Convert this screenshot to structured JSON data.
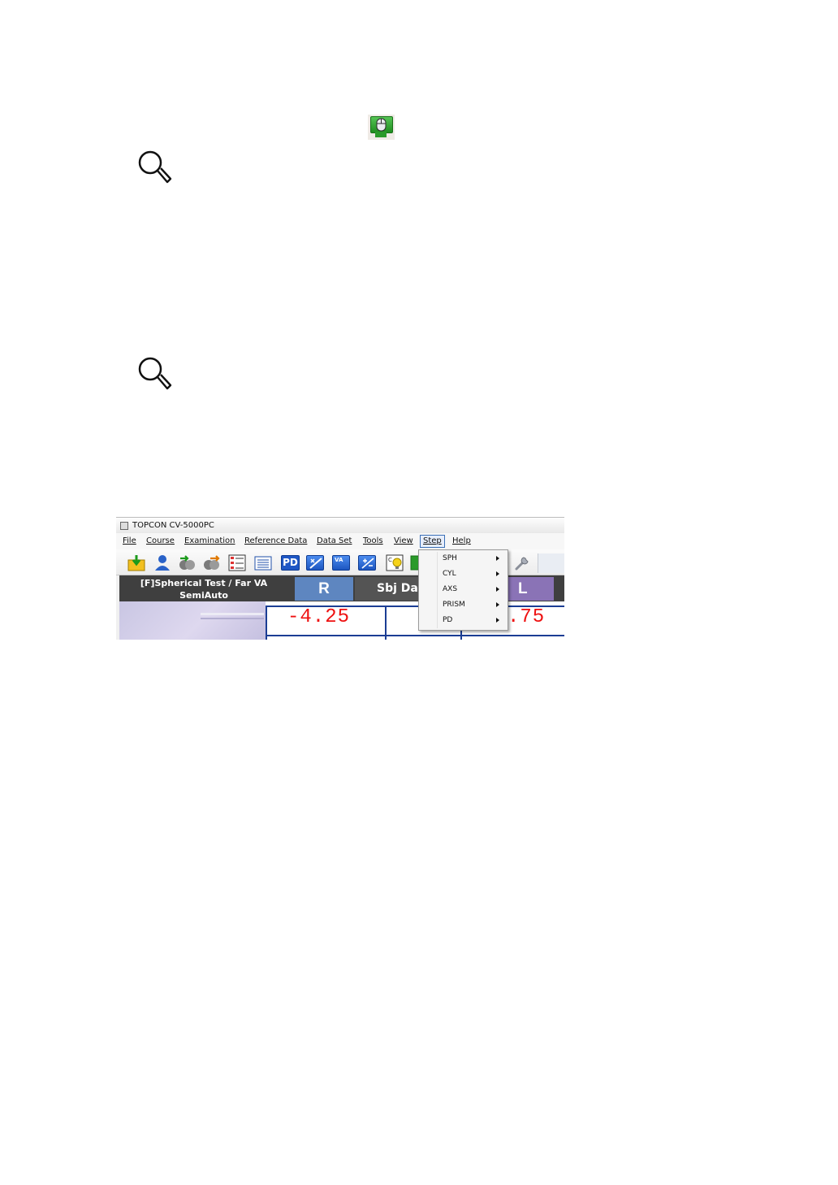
{
  "window": {
    "title": "TOPCON CV-5000PC"
  },
  "menubar": {
    "items": [
      "File",
      "Course",
      "Examination",
      "Reference Data",
      "Data Set",
      "Tools",
      "View",
      "Step",
      "Help"
    ]
  },
  "toolbar": {
    "pd_label": "PD",
    "va_label": "VA"
  },
  "exam": {
    "title_line1": "[F]Spherical Test / Far VA",
    "title_line2": "SemiAuto"
  },
  "tabs": {
    "right": "R",
    "subjective": "Sbj Da",
    "left": "L"
  },
  "values": {
    "right_sph": "-4.25",
    "middle_partial": "",
    "left_sph": ".75"
  },
  "step_menu": {
    "items": [
      "SPH",
      "CYL",
      "AXS",
      "PRISM",
      "PD"
    ]
  },
  "colors": {
    "accent_blue": "#5e86c0",
    "left_purple": "#8a73b6",
    "value_red": "#ee1010",
    "icon_green": "#2a9a2a"
  }
}
